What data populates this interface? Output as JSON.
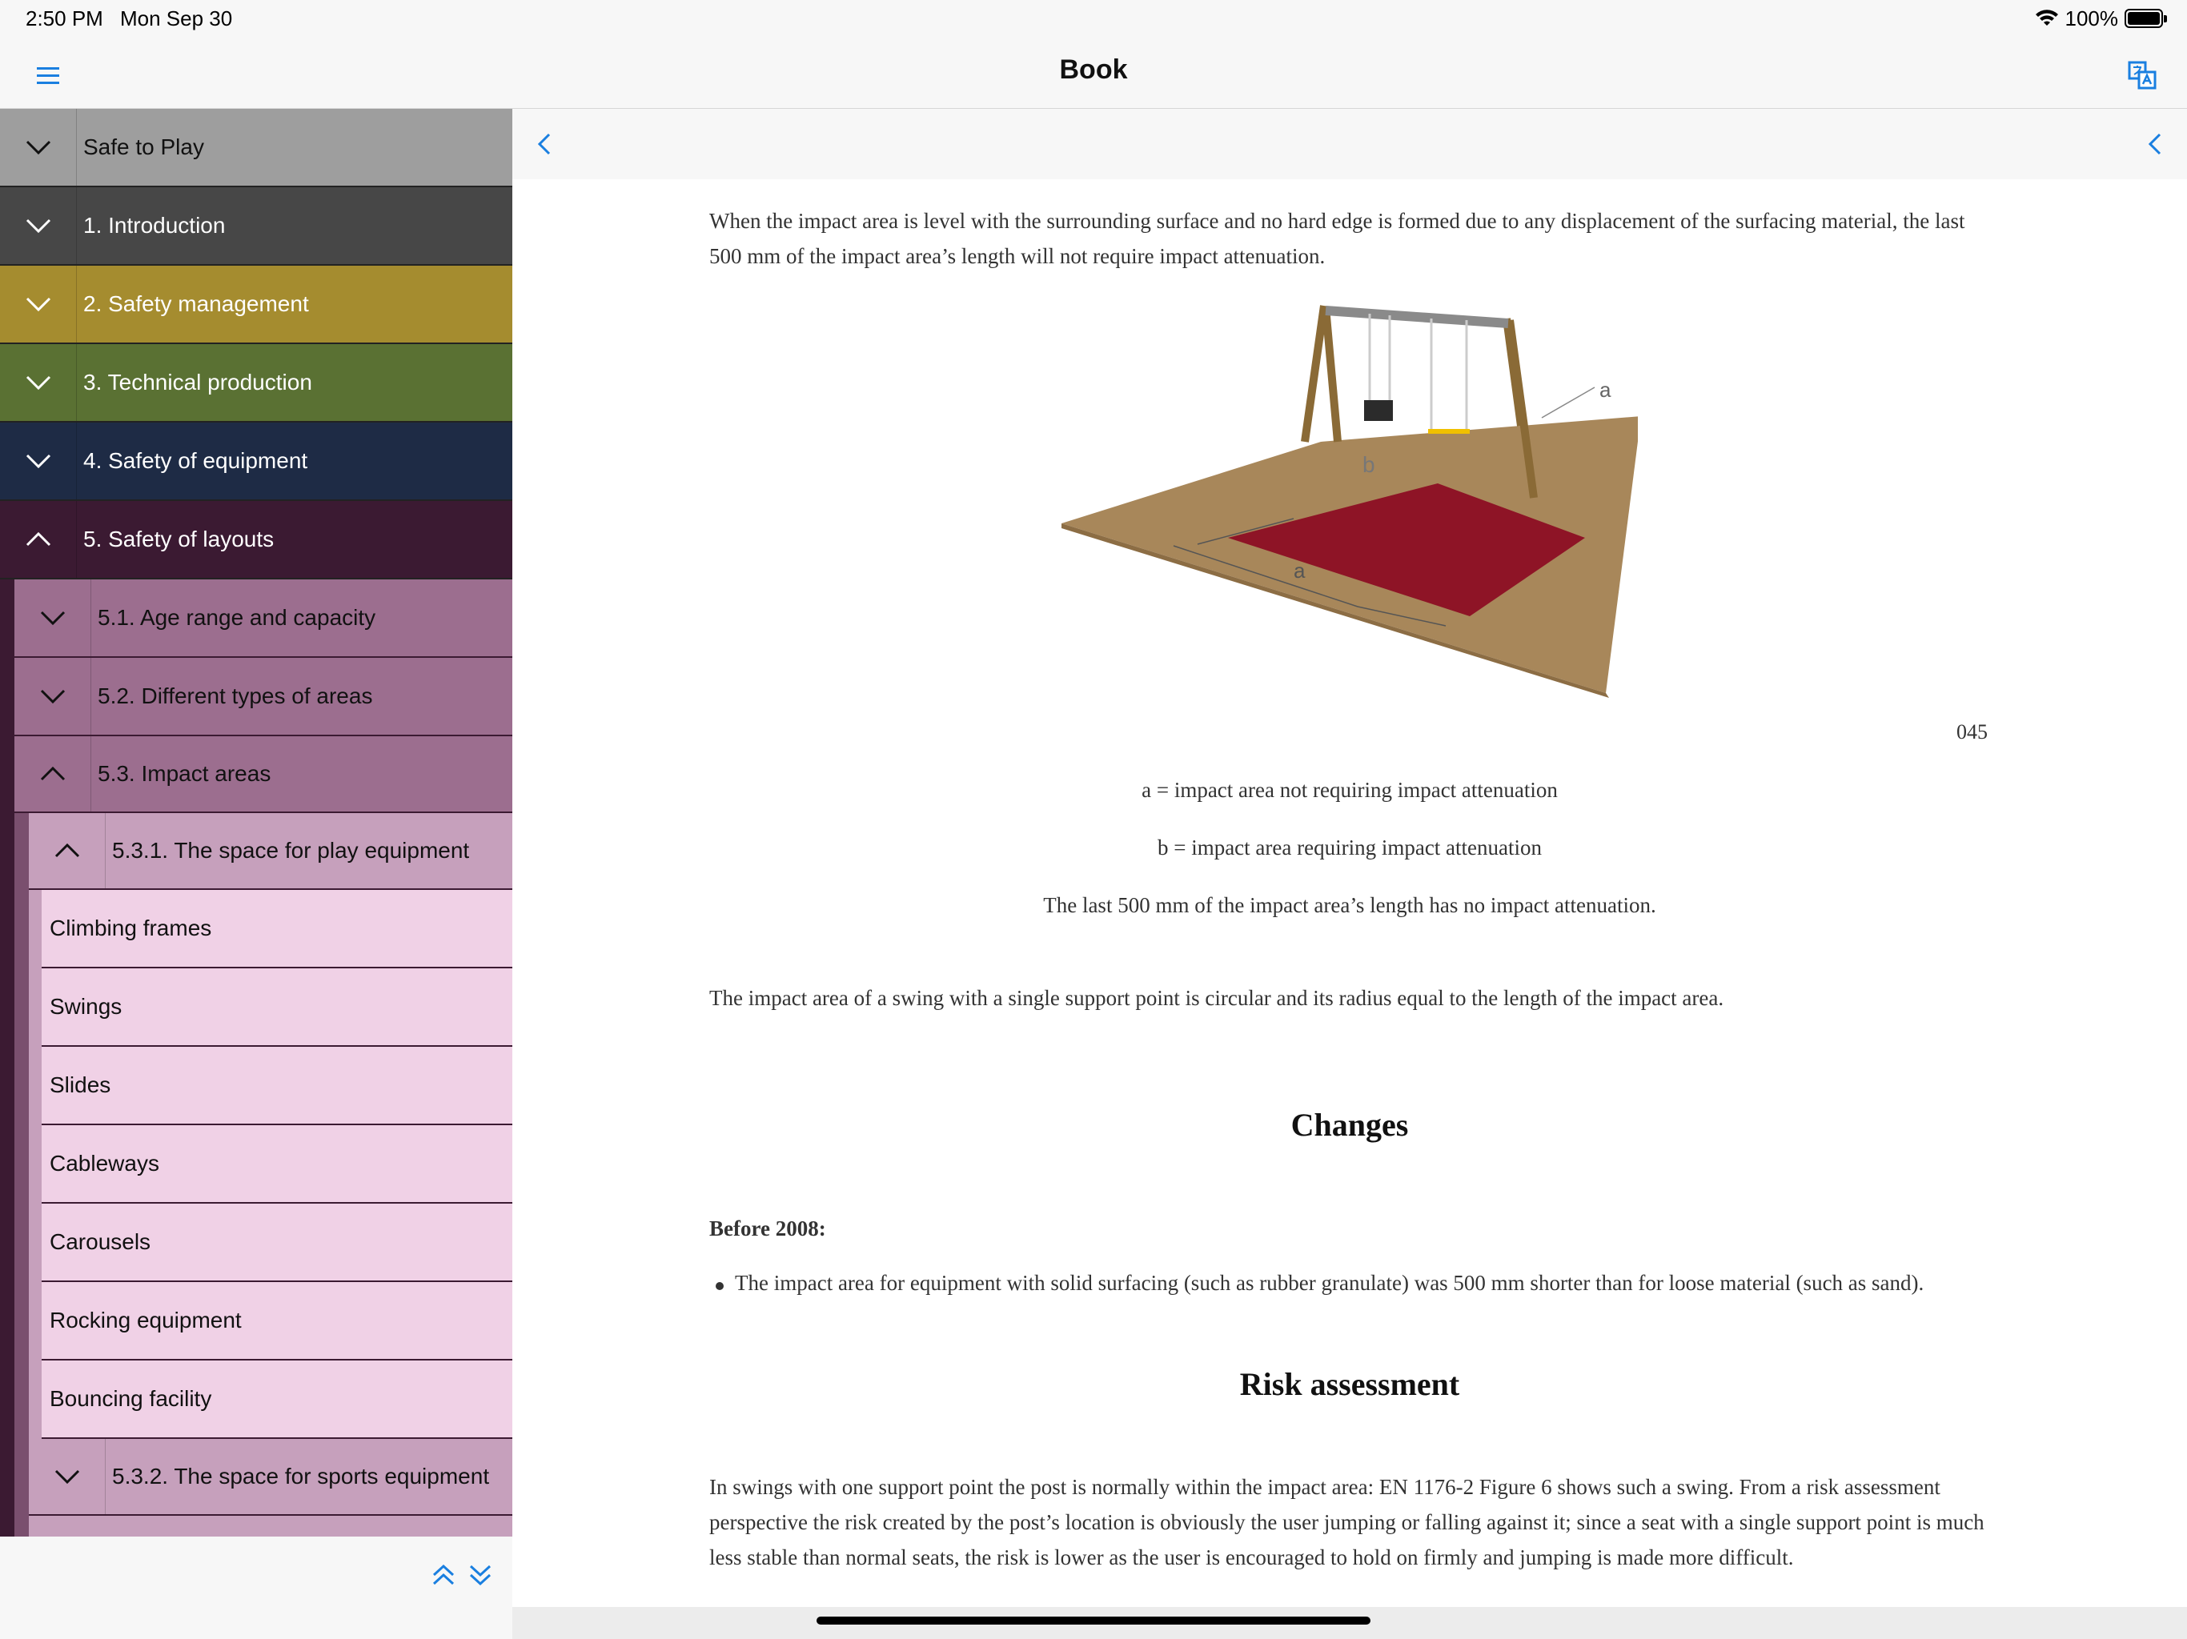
{
  "status": {
    "time": "2:50 PM",
    "date": "Mon Sep 30",
    "battery": "100%"
  },
  "nav": {
    "title": "Book",
    "menu_icon": "hamburger-icon",
    "translate_icon": "translate-icon"
  },
  "sidebar": {
    "sections": [
      {
        "label": "Safe to Play",
        "expanded": false,
        "color": "#9e9e9e",
        "text_color": "#111111"
      },
      {
        "label": "1. Introduction",
        "expanded": false,
        "color": "#474747",
        "text_color": "#ffffff"
      },
      {
        "label": "2. Safety management",
        "expanded": false,
        "color": "#a58c2f",
        "text_color": "#ffffff"
      },
      {
        "label": "3. Technical production",
        "expanded": false,
        "color": "#5a7133",
        "text_color": "#ffffff"
      },
      {
        "label": "4. Safety of equipment",
        "expanded": false,
        "color": "#1e2b45",
        "text_color": "#ffffff"
      },
      {
        "label": "5. Safety of layouts",
        "expanded": true,
        "color": "#3b1a32",
        "text_color": "#ffffff"
      }
    ],
    "subsections": [
      {
        "label": "5.1. Age range and capacity",
        "expanded": false
      },
      {
        "label": "5.2. Different types of areas",
        "expanded": false
      },
      {
        "label": "5.3. Impact areas",
        "expanded": true
      }
    ],
    "subsubsections": [
      {
        "label": "5.3.1. The space for play equipment",
        "expanded": true
      },
      {
        "label": "5.3.2. The space for sports equipment",
        "expanded": false
      }
    ],
    "leaves": [
      "Climbing frames",
      "Swings",
      "Slides",
      "Cableways",
      "Carousels",
      "Rocking equipment",
      "Bouncing facility"
    ]
  },
  "content": {
    "intro_paragraph": "When the impact area is level with the surrounding surface and no hard edge is formed due to any displacement of the surfacing material, the last 500 mm of the impact area’s length will not require impact attenuation.",
    "figure": {
      "label_a_top": "a",
      "label_b": "b",
      "label_a_bottom": "a",
      "number": "045"
    },
    "caption_a": "a = impact area not requiring impact attenuation",
    "caption_b": "b = impact area requiring impact attenuation",
    "caption_c": "The last 500 mm of the impact area’s length has no impact attenuation.",
    "single_support_paragraph": "The impact area of a swing with a single support point is circular and its radius equal to the length of the impact area.",
    "changes_heading": "Changes",
    "before_label": "Before 2008:",
    "before_bullet": "The impact area for equipment with solid surfacing (such as rubber granulate) was 500 mm shorter than for loose material (such as sand).",
    "risk_heading": "Risk assessment",
    "risk_paragraph": "In swings with one support point the post is normally within the impact area: EN 1176-2 Figure 6 shows such a swing. From a risk assessment perspective the risk created by the post’s location is obviously the user jumping or falling against it; since a seat with a single support point is much less stable than normal seats, the risk is lower as the user is encouraged to hold on firmly and jumping is made more difficult."
  },
  "colors": {
    "accent": "#1a7fe0",
    "sub_section": "#9c6e8f",
    "sub_sub_section": "#c6a0bc",
    "leaf": "#f0d1e6",
    "surface": "#a8875a",
    "impact_red": "#8e1426"
  }
}
